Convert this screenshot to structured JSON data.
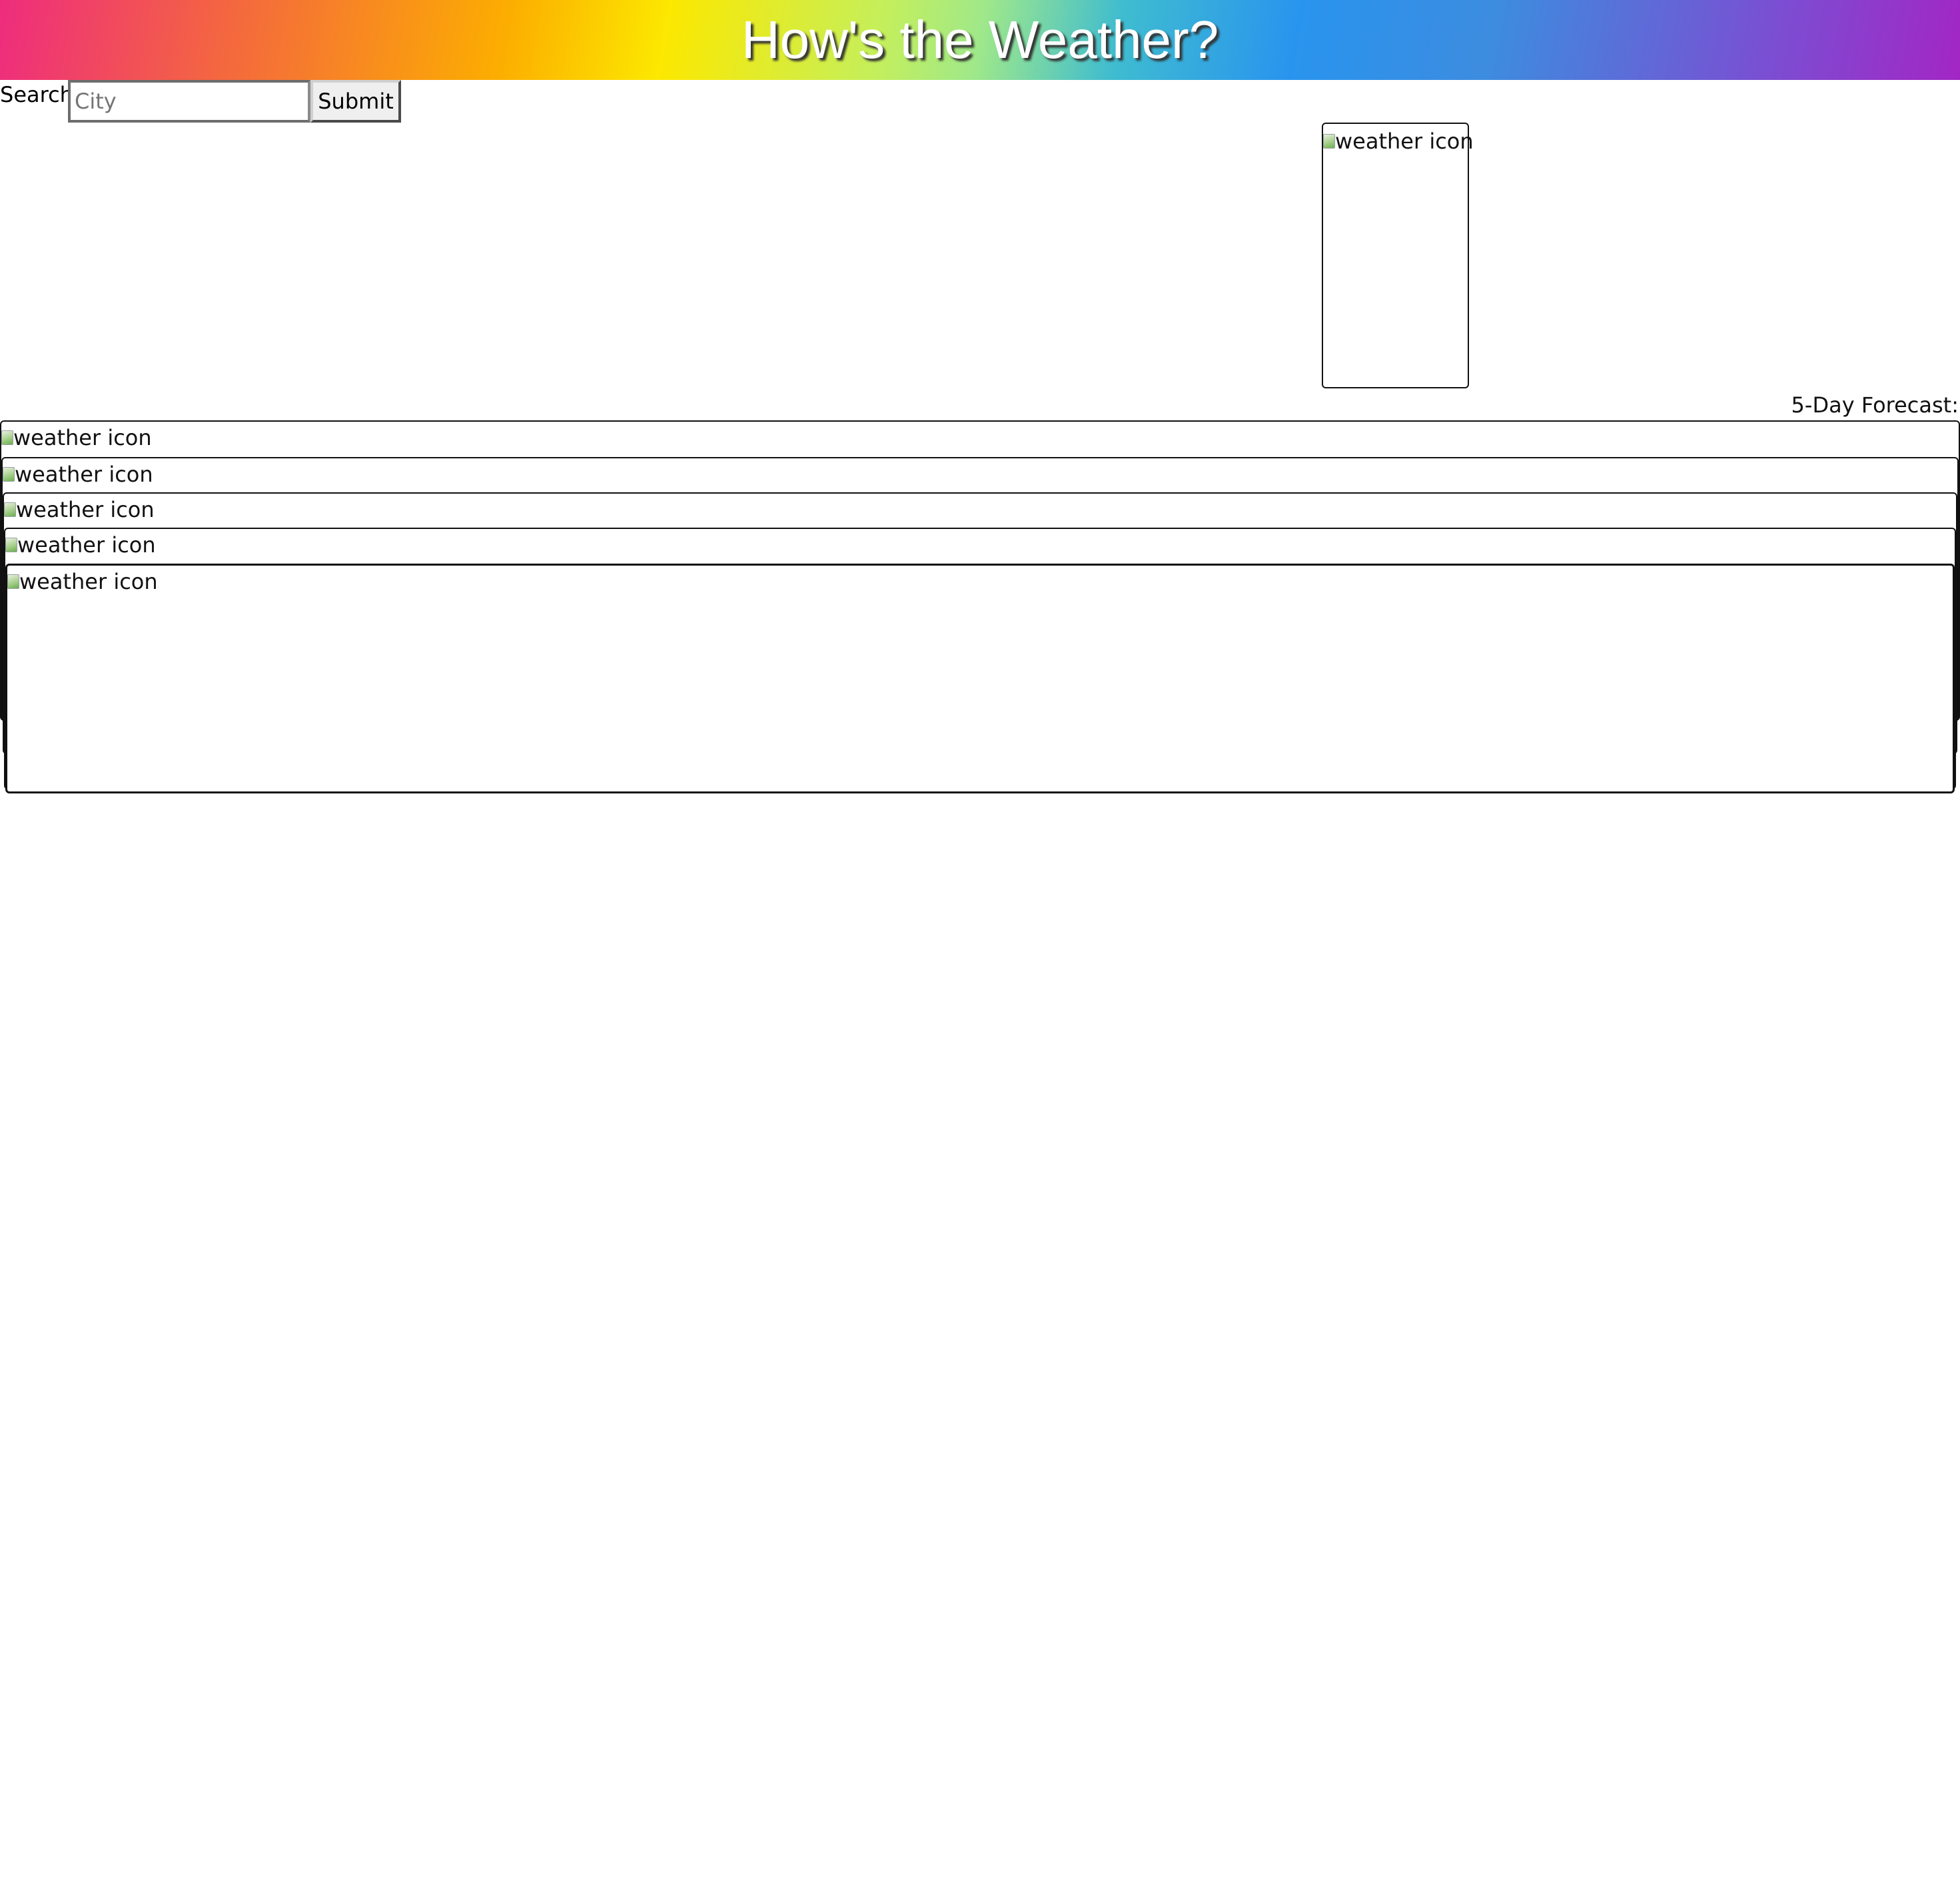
{
  "header": {
    "title": "How's the Weather?"
  },
  "search": {
    "label": "Search",
    "placeholder": "City",
    "value": "",
    "submit_label": "Submit"
  },
  "current": {
    "icon_alt": "weather icon"
  },
  "forecast": {
    "title": "5-Day Forecast:",
    "days": [
      {
        "icon_alt": "weather icon"
      },
      {
        "icon_alt": "weather icon"
      },
      {
        "icon_alt": "weather icon"
      },
      {
        "icon_alt": "weather icon"
      },
      {
        "icon_alt": "weather icon"
      }
    ]
  }
}
